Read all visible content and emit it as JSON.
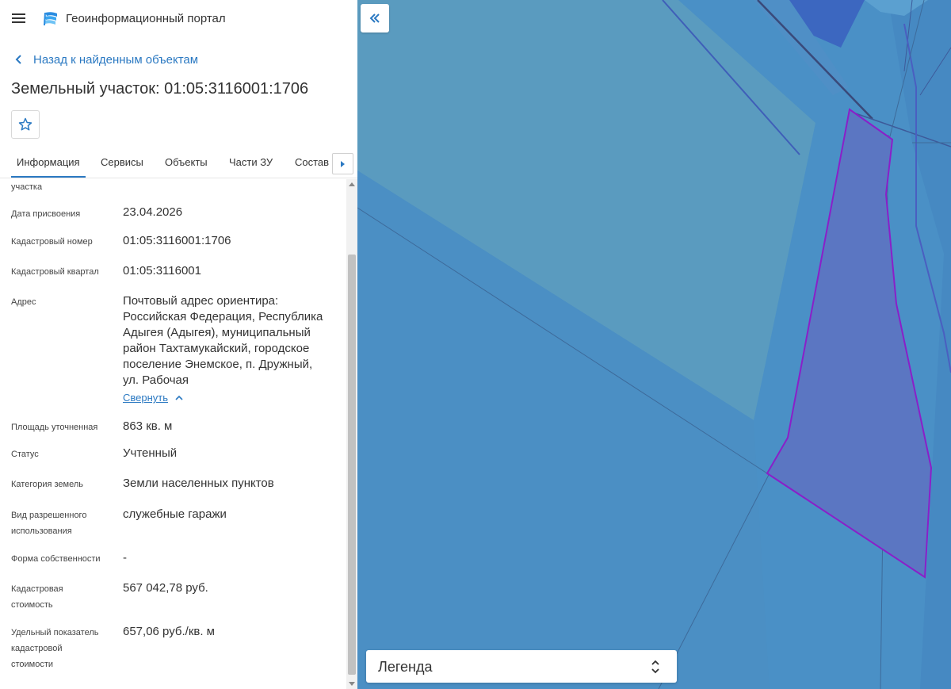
{
  "header": {
    "app_title": "Геоинформационный портал"
  },
  "nav": {
    "back_label": "Назад к найденным объектам"
  },
  "page": {
    "title": "Земельный участок: 01:05:3116001:1706"
  },
  "tabs": [
    {
      "label": "Информация",
      "active": true
    },
    {
      "label": "Сервисы"
    },
    {
      "label": "Объекты"
    },
    {
      "label": "Части ЗУ"
    },
    {
      "label": "Состав"
    }
  ],
  "info": {
    "truncated_label": "участка",
    "rows": [
      {
        "label": "Дата присвоения",
        "value": "23.04.2026"
      },
      {
        "label": "Кадастровый номер",
        "value": "01:05:3116001:1706"
      },
      {
        "label": "Кадастровый квартал",
        "value": "01:05:3116001"
      },
      {
        "label": "Адрес",
        "value_lines": [
          "Почтовый адрес ориентира:",
          "Российская Федерация, Республика",
          "Адыгея (Адыгея), муниципальный",
          "район Тахтамукайский, городское",
          "поселение Энемское, п. Дружный,",
          "ул. Рабочая"
        ]
      },
      {
        "label": "Площадь уточненная",
        "value": "863 кв. м"
      },
      {
        "label": "Статус",
        "value": "Учтенный"
      },
      {
        "label": "Категория земель",
        "value": "Земли населенных пунктов"
      },
      {
        "label_lines": [
          "Вид разрешенного",
          "использования"
        ],
        "value": "служебные гаражи"
      },
      {
        "label": "Форма собственности",
        "value": "-"
      },
      {
        "label_lines": [
          "Кадастровая",
          "стоимость"
        ],
        "value": "567 042,78 руб."
      },
      {
        "label_lines": [
          "Удельный показатель",
          "кадастровой",
          "стоимости"
        ],
        "value": "657,06 руб./кв. м"
      }
    ],
    "collapse_label": "Свернуть"
  },
  "map": {
    "legend_label": "Легенда",
    "colors": {
      "water": "#4a90c6",
      "parcel_fill": "#5b76c2",
      "parcel_stroke": "#8a1fc9",
      "block": "#3c67c0"
    }
  },
  "icons": {
    "menu": "menu-icon",
    "logo": "logo-icon",
    "back": "chevron-left-icon",
    "favorite": "star-icon",
    "tabs_next": "caret-right-icon",
    "collapse": "chevron-up-icon",
    "panel_toggle": "double-chevron-left-icon",
    "legend_toggle": "up-down-icon"
  }
}
